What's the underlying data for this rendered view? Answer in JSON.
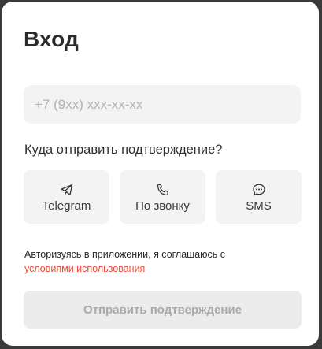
{
  "login": {
    "title": "Вход",
    "phone": {
      "value": "",
      "placeholder": "+7 (9xx) xxx-xx-xx"
    },
    "question": "Куда отправить подтверждение?",
    "methods": [
      {
        "label": "Telegram",
        "icon": "telegram-icon"
      },
      {
        "label": "По звонку",
        "icon": "phone-icon"
      },
      {
        "label": "SMS",
        "icon": "sms-icon"
      }
    ],
    "terms_text": "Авторизуясь в приложении, я соглашаюсь с",
    "terms_link": "условиями использования",
    "submit_label": "Отправить подтверждение"
  },
  "colors": {
    "overlay": "#3a3a3a",
    "card": "#ffffff",
    "field_bg": "#f3f3f3",
    "link": "#e94c33",
    "disabled_text": "#a9a9a9"
  }
}
